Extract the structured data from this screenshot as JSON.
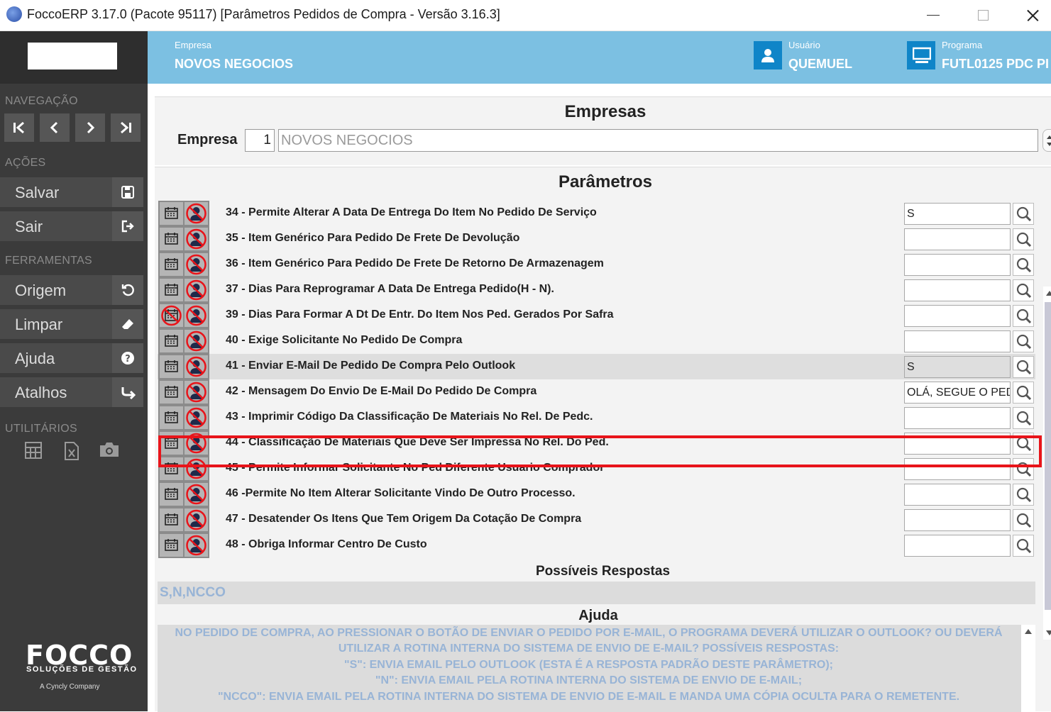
{
  "window": {
    "title": "FoccoERP 3.17.0 (Pacote 95117) [Parâmetros Pedidos de Compra - Versão 3.16.3]",
    "icons": [
      "app-icon",
      "minimize-icon",
      "maximize-icon",
      "close-icon"
    ]
  },
  "sidebar": {
    "nav_label": "NAVEGAÇÃO",
    "nav_icons": [
      "first-record-icon",
      "previous-record-icon",
      "next-record-icon",
      "last-record-icon"
    ],
    "actions_label": "AÇÕES",
    "actions": [
      {
        "label": "Salvar",
        "icon": "save-icon"
      },
      {
        "label": "Sair",
        "icon": "exit-icon"
      }
    ],
    "tools_label": "FERRAMENTAS",
    "tools": [
      {
        "label": "Origem",
        "icon": "refresh-icon"
      },
      {
        "label": "Limpar",
        "icon": "eraser-icon"
      },
      {
        "label": "Ajuda",
        "icon": "help-icon"
      },
      {
        "label": "Atalhos",
        "icon": "shortcut-icon"
      }
    ],
    "utils_label": "UTILITÁRIOS",
    "util_icons": [
      "calculator-icon",
      "excel-icon",
      "camera-icon"
    ],
    "logo": {
      "name": "FOCCO",
      "tagline": "SOLUÇÕES DE GESTÃO",
      "company": "A Cyncly Company"
    }
  },
  "header": {
    "empresa_label": "Empresa",
    "empresa_value": "NOVOS NEGOCIOS",
    "usuario_label": "Usuário",
    "usuario_value": "QUEMUEL",
    "programa_label": "Programa",
    "programa_value": "FUTL0125 PDC PI",
    "colors": {
      "header_bg": "#7cc0e2",
      "icon_bg": "#0f85c8"
    }
  },
  "empresas_panel": {
    "title": "Empresas",
    "field_label": "Empresa",
    "code": "1",
    "name": "NOVOS NEGOCIOS"
  },
  "parametros_panel": {
    "title": "Parâmetros",
    "rows": [
      {
        "label": "34 - Permite Alterar A Data De Entrega Do Item No Pedido De Serviço",
        "value": "S",
        "calendar_disabled": false
      },
      {
        "label": "35 - Item Genérico Para Pedido De Frete De Devolução",
        "value": "",
        "calendar_disabled": false
      },
      {
        "label": "36 - Item Genérico Para Pedido De Frete De Retorno De Armazenagem",
        "value": "",
        "calendar_disabled": false
      },
      {
        "label": "37 - Dias Para Reprogramar A Data De Entrega Pedido(H - N).",
        "value": "",
        "calendar_disabled": false
      },
      {
        "label": "39 - Dias Para Formar A Dt De Entr. Do Item Nos Ped. Gerados Por Safra",
        "value": "",
        "calendar_disabled": true
      },
      {
        "label": "40 - Exige Solicitante No Pedido De Compra",
        "value": "",
        "calendar_disabled": false
      },
      {
        "label": "41 - Enviar E-Mail De Pedido De Compra Pelo Outlook",
        "value": "S",
        "calendar_disabled": false,
        "selected": true
      },
      {
        "label": "42 - Mensagem Do Envio De E-Mail Do Pedido De Compra",
        "value": "OLÁ, SEGUE O PEDI",
        "calendar_disabled": false
      },
      {
        "label": "43 - Imprimir Código Da Classificação De Materiais No Rel. De Pedc.",
        "value": "",
        "calendar_disabled": false
      },
      {
        "label": "44 - Classificação De Materiais Que Deve Ser Impressa No Rel. Do Ped.",
        "value": "",
        "calendar_disabled": false
      },
      {
        "label": "45 - Permite Informar Solicitante No Ped Diferente Usuario Comprador",
        "value": "",
        "calendar_disabled": false
      },
      {
        "label": "46 -Permite No Item Alterar Solicitante Vindo De Outro Processo.",
        "value": "",
        "calendar_disabled": false
      },
      {
        "label": "47 - Desatender Os Itens Que Tem Origem Da Cotação De Compra",
        "value": "",
        "calendar_disabled": false
      },
      {
        "label": "48 - Obriga Informar Centro De Custo",
        "value": "",
        "calendar_disabled": false
      }
    ],
    "row_icons": [
      "calendar-icon",
      "user-blocked-icon",
      "search-icon"
    ],
    "highlight_color": "#e8141a"
  },
  "possiveis_respostas": {
    "title": "Possíveis Respostas",
    "value": "S,N,NCCO"
  },
  "ajuda": {
    "title": "Ajuda",
    "lines": [
      "NO PEDIDO DE COMPRA, AO PRESSIONAR O BOTÃO DE ENVIAR O PEDIDO POR E-MAIL, O PROGRAMA DEVERÁ UTILIZAR O OUTLOOK? OU DEVERÁ",
      "UTILIZAR A ROTINA INTERNA DO SISTEMA DE ENVIO DE E-MAIL? POSSÍVEIS RESPOSTAS:",
      "\"S\": ENVIA EMAIL PELO OUTLOOK (ESTA É A RESPOSTA PADRÃO DESTE PARÂMETRO);",
      "\"N\": ENVIA EMAIL PELA ROTINA INTERNA DO SISTEMA DE ENVIO DE E-MAIL;",
      "\"NCCO\": ENVIA EMAIL PELA ROTINA INTERNA DO SISTEMA DE ENVIO DE E-MAIL E MANDA UMA CÓPIA OCULTA PARA O REMETENTE."
    ]
  }
}
